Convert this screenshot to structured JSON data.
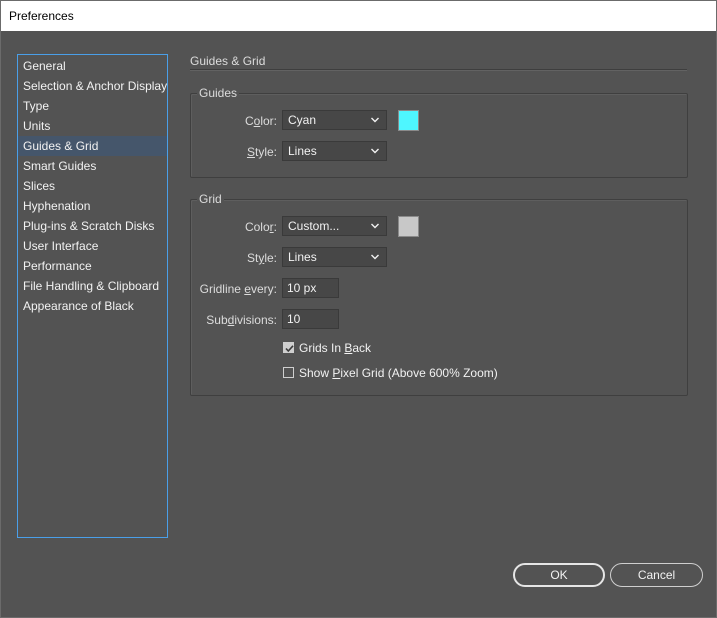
{
  "window": {
    "title": "Preferences"
  },
  "sidebar": {
    "items": [
      {
        "label": "General"
      },
      {
        "label": "Selection & Anchor Display"
      },
      {
        "label": "Type"
      },
      {
        "label": "Units"
      },
      {
        "label": "Guides & Grid",
        "selected": true
      },
      {
        "label": "Smart Guides"
      },
      {
        "label": "Slices"
      },
      {
        "label": "Hyphenation"
      },
      {
        "label": "Plug-ins & Scratch Disks"
      },
      {
        "label": "User Interface"
      },
      {
        "label": "Performance"
      },
      {
        "label": "File Handling & Clipboard"
      },
      {
        "label": "Appearance of Black"
      }
    ]
  },
  "section": {
    "title": "Guides & Grid"
  },
  "guides": {
    "label": "Guides",
    "color_label_pre": "C",
    "color_label_u": "o",
    "color_label_post": "lor:",
    "color_value": "Cyan",
    "color_swatch": "#4ef6ff",
    "style_label_pre": "",
    "style_label_u": "S",
    "style_label_post": "tyle:",
    "style_value": "Lines"
  },
  "grid": {
    "label": "Grid",
    "color_label_pre": "Colo",
    "color_label_u": "r",
    "color_label_post": ":",
    "color_value": "Custom...",
    "color_swatch": "#c8c8c8",
    "style_label_pre": "St",
    "style_label_u": "y",
    "style_label_post": "le:",
    "style_value": "Lines",
    "gridline_label_pre": "Gridline ",
    "gridline_label_u": "e",
    "gridline_label_post": "very:",
    "gridline_value": "10 px",
    "subdiv_label_pre": "Sub",
    "subdiv_label_u": "d",
    "subdiv_label_post": "ivisions:",
    "subdiv_value": "10",
    "grids_in_back_pre": "Grids In ",
    "grids_in_back_u": "B",
    "grids_in_back_post": "ack",
    "grids_in_back_checked": true,
    "pixel_grid_pre": "Show ",
    "pixel_grid_u": "P",
    "pixel_grid_post": "ixel Grid (Above 600% Zoom)",
    "pixel_grid_checked": false
  },
  "buttons": {
    "ok": "OK",
    "cancel": "Cancel"
  },
  "colors": {
    "accent": "#4a9fe8",
    "panel_bg": "#535353",
    "selected_bg": "#45566b"
  }
}
